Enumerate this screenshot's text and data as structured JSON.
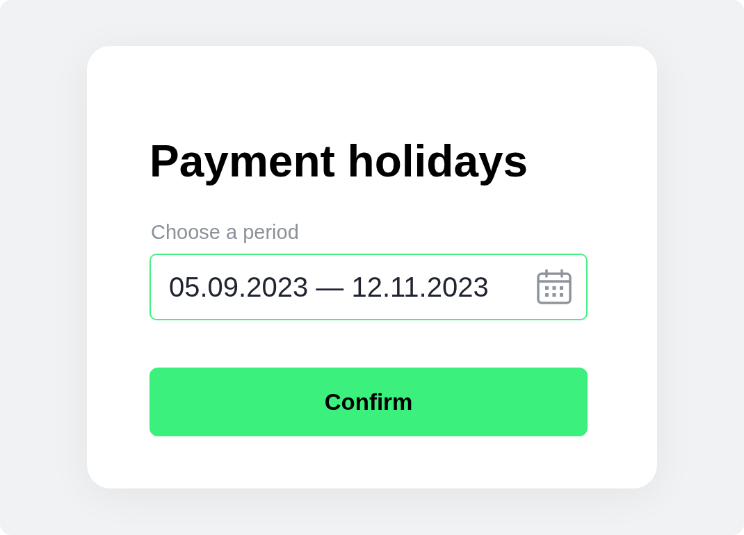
{
  "title": "Payment holidays",
  "period_field": {
    "label": "Choose a period",
    "value": "05.09.2023 — 12.11.2023",
    "focused": true
  },
  "confirm_button": {
    "label": "Confirm"
  }
}
